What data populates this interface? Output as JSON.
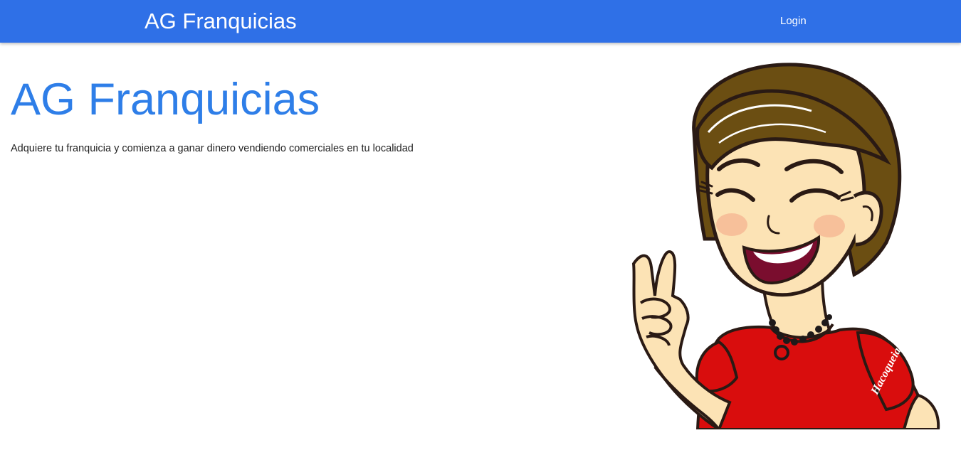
{
  "navbar": {
    "brand": "AG Franquicias",
    "login_label": "Login",
    "background_color": "#2f70e7"
  },
  "hero": {
    "title": "AG Franquicias",
    "subtitle": "Adquiere tu franquicia y comienza a ganar dinero vendiendo comerciales en tu localidad",
    "title_color": "#2e7ee8"
  },
  "mascot": {
    "icon": "cartoon-woman-peace-sign",
    "shirt_logo": "Hacoqueia"
  }
}
